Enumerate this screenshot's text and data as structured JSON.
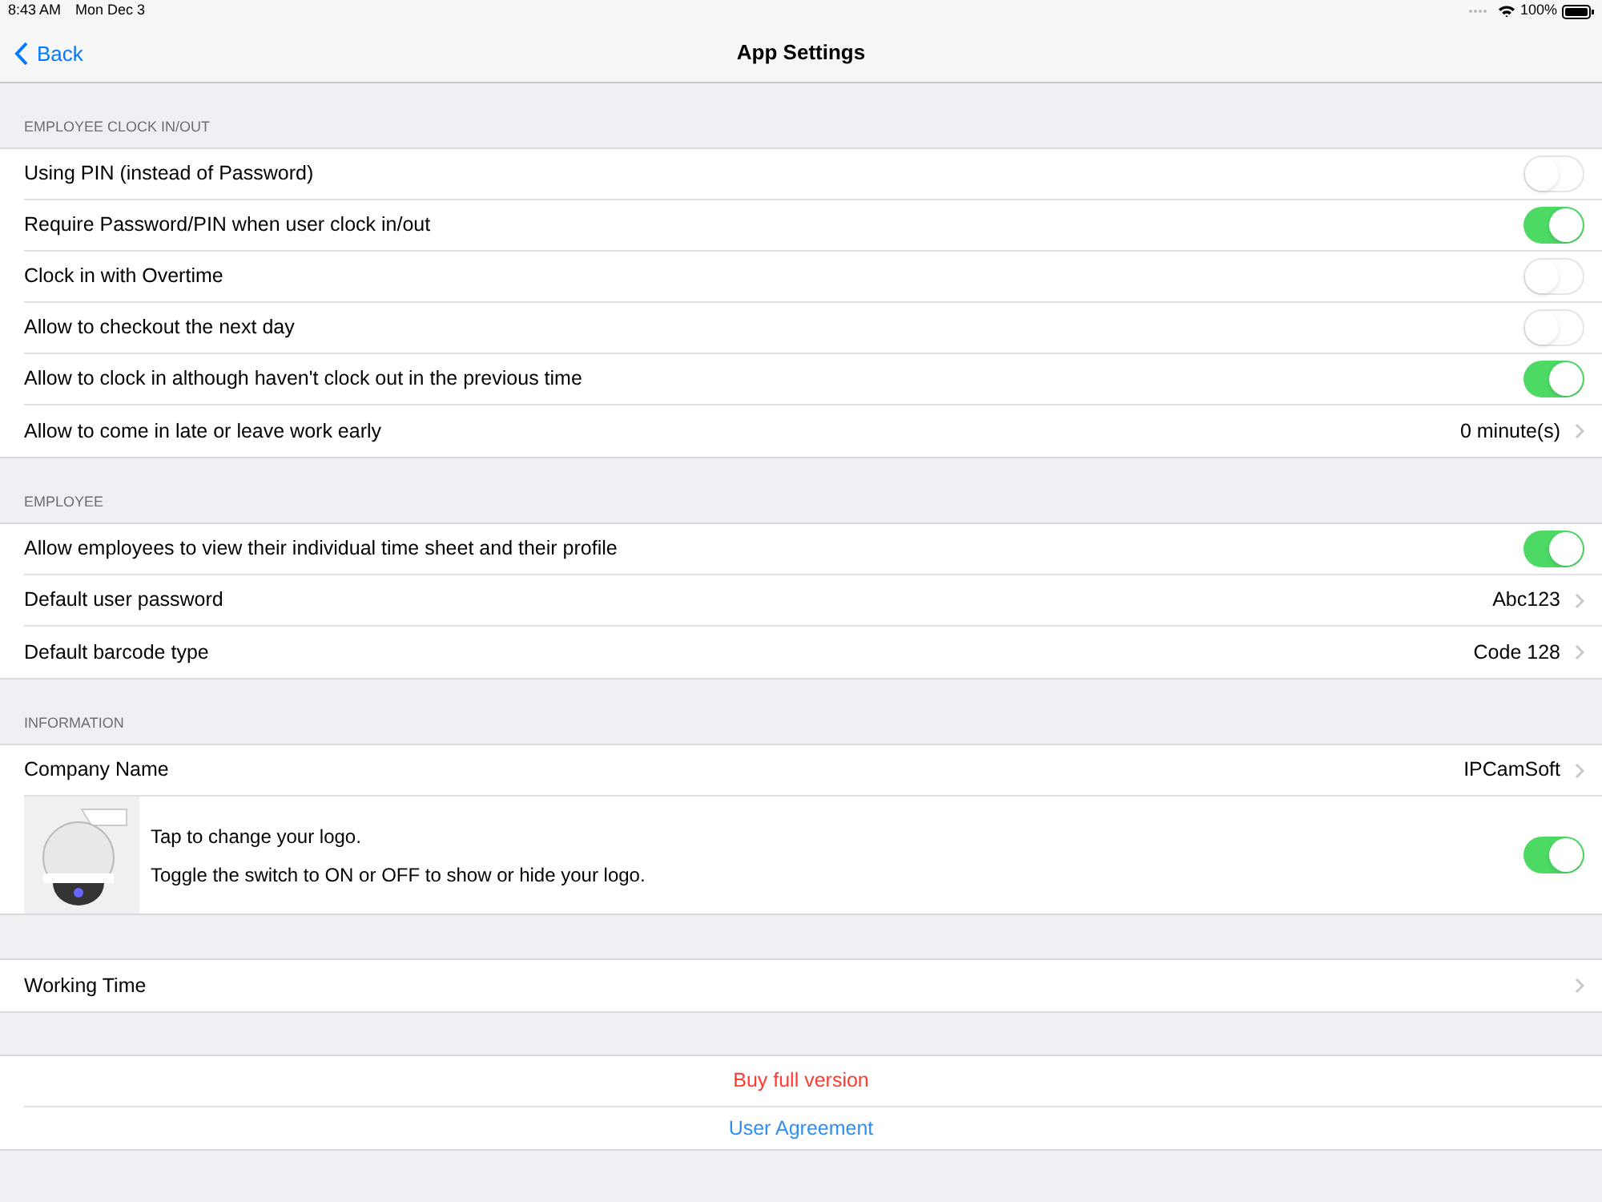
{
  "status_bar": {
    "time": "8:43 AM",
    "date": "Mon Dec 3",
    "battery": "100%"
  },
  "nav": {
    "back": "Back",
    "title": "App Settings"
  },
  "sections": [
    {
      "header": "EMPLOYEE CLOCK IN/OUT",
      "rows": [
        {
          "kind": "toggle",
          "label": "Using PIN (instead of Password)",
          "on": false
        },
        {
          "kind": "toggle",
          "label": "Require Password/PIN when user clock in/out",
          "on": true
        },
        {
          "kind": "toggle",
          "label": "Clock in with Overtime",
          "on": false
        },
        {
          "kind": "toggle",
          "label": "Allow to checkout the next day",
          "on": false
        },
        {
          "kind": "toggle",
          "label": "Allow to clock in although haven't clock out in the previous time",
          "on": true
        },
        {
          "kind": "detail",
          "label": "Allow to come in late or leave work early",
          "value": "0 minute(s)"
        }
      ]
    },
    {
      "header": "EMPLOYEE",
      "rows": [
        {
          "kind": "toggle",
          "label": "Allow employees to view their individual time sheet and their profile",
          "on": true
        },
        {
          "kind": "detail",
          "label": "Default user password",
          "value": "Abc123"
        },
        {
          "kind": "detail",
          "label": "Default barcode type",
          "value": "Code 128"
        }
      ]
    },
    {
      "header": "INFORMATION",
      "rows": [
        {
          "kind": "detail",
          "label": "Company Name",
          "value": "IPCamSoft"
        },
        {
          "kind": "logo",
          "lines": [
            "Tap to change your logo.",
            "Toggle the switch to ON or OFF to show or hide your logo."
          ],
          "on": true
        }
      ]
    },
    {
      "rows": [
        {
          "kind": "detail",
          "label": "Working Time"
        }
      ]
    }
  ],
  "actions": [
    {
      "label": "Buy full version",
      "color": "#ff3b30"
    },
    {
      "label": "User Agreement",
      "color": "#2f8ff0"
    }
  ]
}
